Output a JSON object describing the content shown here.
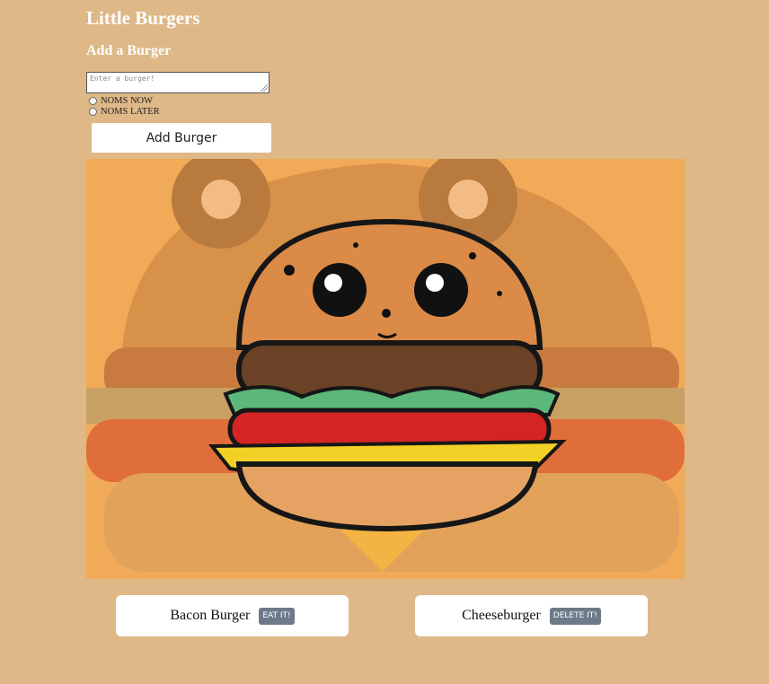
{
  "header": {
    "title": "Little Burgers",
    "subtitle": "Add a Burger"
  },
  "form": {
    "input_placeholder": "Enter a burger!",
    "input_value": "",
    "options": [
      {
        "label": "NOMS NOW",
        "checked": false
      },
      {
        "label": "NOMS LATER",
        "checked": false
      }
    ],
    "submit_label": "Add Burger"
  },
  "hero": {
    "icon": "cartoon-burger-image"
  },
  "burgers": [
    {
      "name": "Bacon Burger",
      "action_label": "EAT IT!"
    },
    {
      "name": "Cheeseburger",
      "action_label": "DELETE IT!"
    }
  ],
  "colors": {
    "background": "#deb887",
    "button": "#6c7a89"
  }
}
